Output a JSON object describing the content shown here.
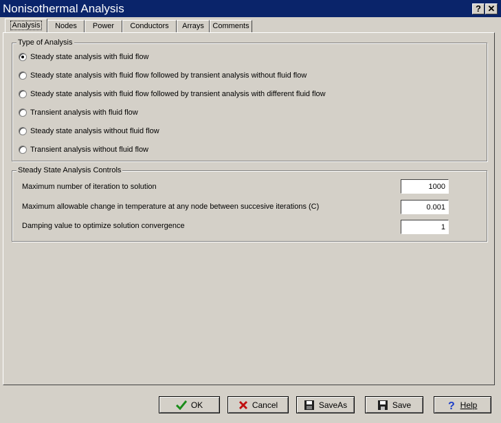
{
  "window": {
    "title": "Nonisothermal Analysis",
    "help_glyph": "?",
    "close_glyph": "✕"
  },
  "tabs": [
    {
      "label": "Analysis",
      "active": true
    },
    {
      "label": "Nodes"
    },
    {
      "label": "Power"
    },
    {
      "label": "Conductors"
    },
    {
      "label": "Arrays"
    },
    {
      "label": "Comments"
    }
  ],
  "analysis_type": {
    "legend": "Type of Analysis",
    "options": [
      {
        "label": "Steady state analysis with fluid flow",
        "selected": true
      },
      {
        "label": "Steady state analysis with fluid flow followed by transient analysis without fluid flow",
        "selected": false
      },
      {
        "label": "Steady state analysis with fluid flow followed by transient analysis with different fluid flow",
        "selected": false
      },
      {
        "label": "Transient analysis with fluid flow",
        "selected": false
      },
      {
        "label": "Steady state analysis without fluid flow",
        "selected": false
      },
      {
        "label": "Transient analysis without fluid flow",
        "selected": false
      }
    ]
  },
  "steady_controls": {
    "legend": "Steady State Analysis Controls",
    "fields": [
      {
        "label": "Maximum number of iteration to solution",
        "value": "1000"
      },
      {
        "label": "Maximum allowable change in temperature at any node between succesive iterations (C)",
        "value": "0.001"
      },
      {
        "label": "Damping value to optimize solution convergence",
        "value": "1"
      }
    ]
  },
  "buttons": {
    "ok": "OK",
    "cancel": "Cancel",
    "saveas": "SaveAs",
    "save": "Save",
    "help": "Help"
  },
  "colors": {
    "titlebar": "#0a246a",
    "face": "#d4d0c8",
    "ok_check": "#1a8c1a",
    "cancel_x": "#c01010",
    "help_q": "#1a3cc8"
  }
}
